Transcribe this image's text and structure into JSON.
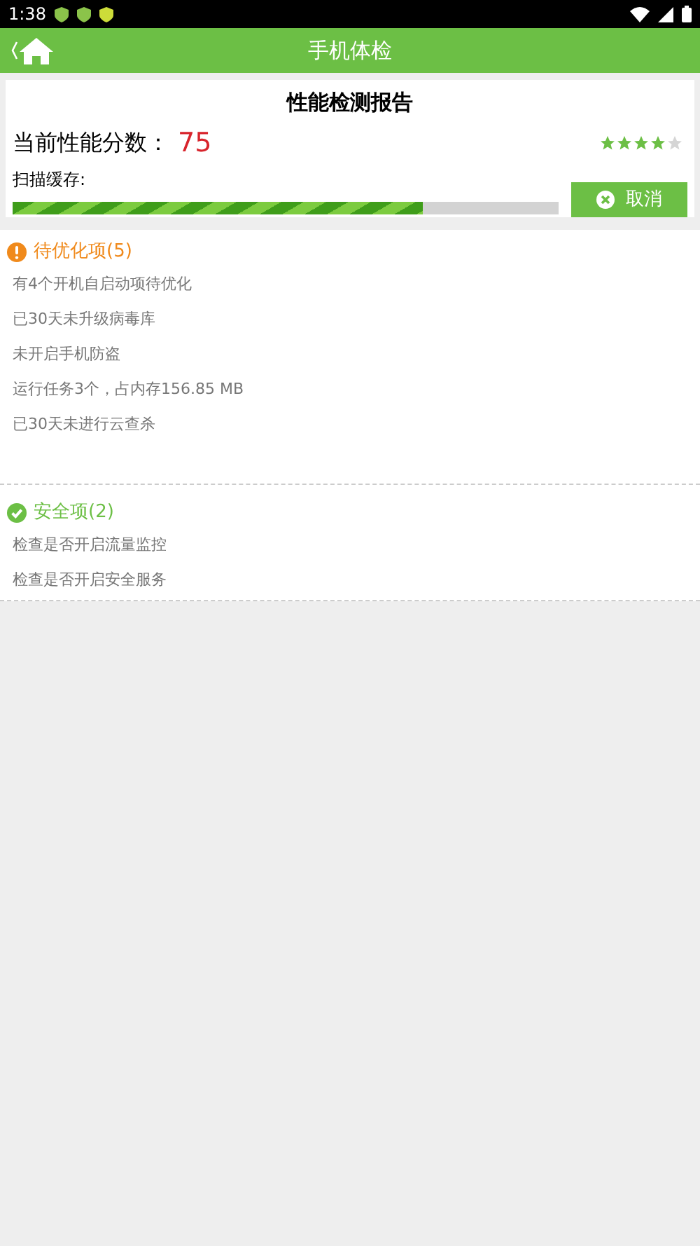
{
  "status_bar": {
    "time": "1:38"
  },
  "header": {
    "title": "手机体检"
  },
  "report": {
    "title": "性能检测报告",
    "score_label": "当前性能分数：",
    "score": "75",
    "stars": 4,
    "scan_label": "扫描缓存:",
    "progress": {
      "level": 0.75
    },
    "cancel_button": "取消"
  },
  "sections": [
    {
      "kind": "warning",
      "title": "待优化项(5)",
      "items": [
        "有4个开机自启动项待优化",
        "已30天未升级病毒库",
        "未开启手机防盗",
        "运行任务3个，占内存156.85 MB",
        "已30天未进行云查杀"
      ]
    },
    {
      "kind": "safe",
      "title": "安全项(2)",
      "items": [
        "检查是否开启流量监控",
        "检查是否开启安全服务"
      ]
    }
  ]
}
